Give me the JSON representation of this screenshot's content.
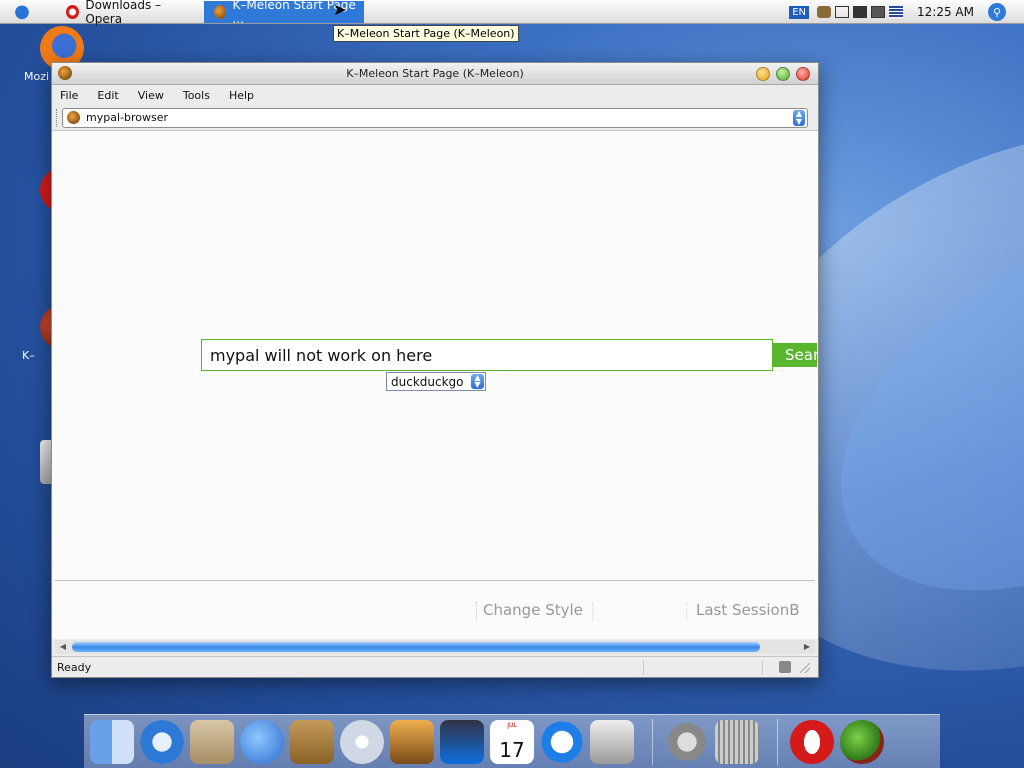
{
  "taskbar": {
    "tasks": [
      {
        "label": "Downloads – Opera"
      },
      {
        "label": "K–Meleon Start Page ..."
      }
    ],
    "language": "EN",
    "clock": "12:25 AM"
  },
  "tooltip": "K–Meleon Start Page (K–Meleon)",
  "desktop_icons": [
    {
      "label": "Mozi"
    },
    {
      "label": "K–"
    }
  ],
  "window": {
    "title": "K–Meleon Start Page (K–Meleon)",
    "menu": [
      "File",
      "Edit",
      "View",
      "Tools",
      "Help"
    ],
    "url_value": "mypal-browser",
    "search": {
      "query": "mypal will not work on here",
      "button_label": "Sear",
      "engine": "duckduckgo"
    },
    "footer": {
      "change_style": "Change Style",
      "last_session": "Last SessionB"
    },
    "status": "Ready"
  },
  "dock": {
    "calendar_month": "JUL",
    "calendar_day": "17"
  },
  "colors": {
    "accent": "#2f7ad8",
    "search_green": "#59b52e",
    "desktop_blue": "#2a5aa8"
  }
}
